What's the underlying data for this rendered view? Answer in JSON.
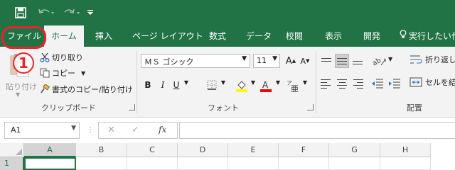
{
  "quick_access": {
    "save_icon": "save-icon",
    "undo_icon": "undo-icon",
    "redo_icon": "redo-icon",
    "customize_icon": "customize-dropdown-icon"
  },
  "tabs": {
    "file": "ファイル",
    "home": "ホーム",
    "insert": "挿入",
    "page_layout": "ページ レイアウト",
    "formulas": "数式",
    "data": "データ",
    "review": "校閲",
    "view": "表示",
    "developer": "開発",
    "tell_me": "実行したい作"
  },
  "annotation": {
    "step": "1"
  },
  "clipboard": {
    "paste": "貼り付け",
    "cut": "切り取り",
    "copy": "コピー",
    "format_painter": "書式のコピー/貼り付け",
    "group_label": "クリップボード"
  },
  "font": {
    "name": "ＭＳ ゴシック",
    "size": "11",
    "group_label": "フォント",
    "bold": "B",
    "italic": "I",
    "underline": "U",
    "grow": "A",
    "shrink": "A"
  },
  "alignment": {
    "wrap_text": "折り返し",
    "merge_center": "セルを結",
    "group_label": "配置"
  },
  "formula_bar": {
    "name_box": "A1",
    "cancel": "✕",
    "enter": "✓",
    "fx": "fx",
    "formula": ""
  },
  "grid": {
    "columns": [
      "A",
      "B",
      "C",
      "D",
      "E",
      "F",
      "G",
      "H"
    ],
    "rows": [
      "1"
    ]
  },
  "colors": {
    "excel_green": "#217346",
    "ribbon_bg": "#f3f3f3",
    "annotation_red": "#e8242b",
    "fill_yellow": "#ffff00",
    "font_red": "#ff0000"
  }
}
